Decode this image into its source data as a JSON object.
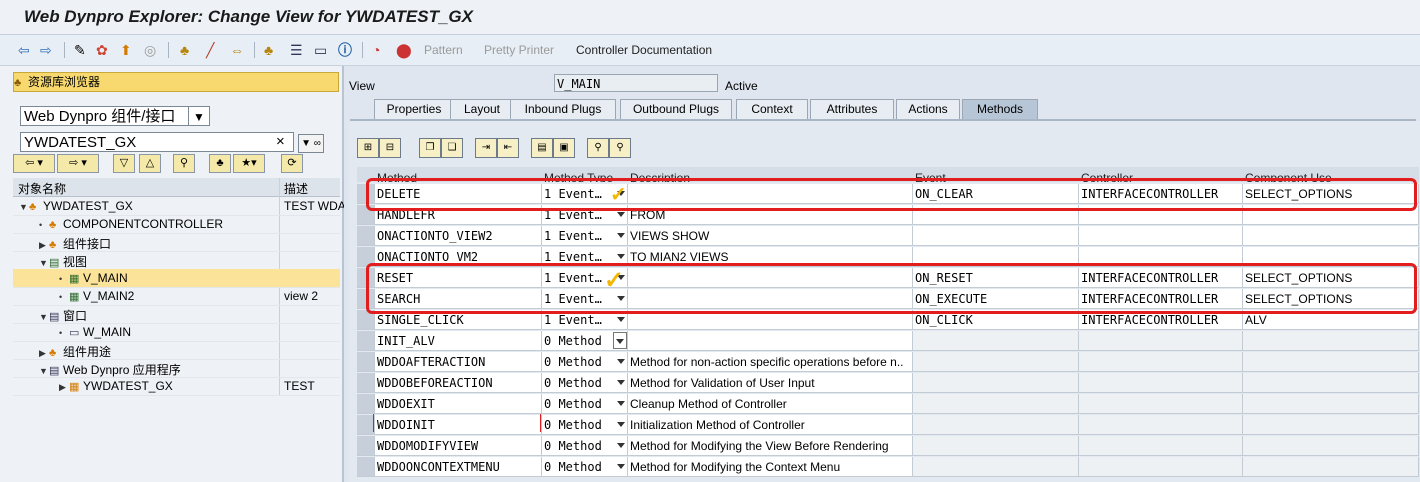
{
  "window": {
    "title": "Web Dynpro Explorer: Change View for YWDATEST_GX"
  },
  "toolbar": {
    "items": [
      "Pattern",
      "Pretty Printer",
      "Controller Documentation"
    ],
    "icons": [
      "back-icon",
      "forward-icon",
      "other-object-icon",
      "display-change-icon",
      "activate-icon",
      "where-used-icon",
      "mode-icon",
      "navigation-icon",
      "edit-icon",
      "check-icon",
      "hierarchy-icon",
      "enhance-icon",
      "layout-icon",
      "info-icon",
      "stop-icon",
      "test-icon"
    ]
  },
  "left": {
    "header": "资源库浏览器",
    "object_type": "Web Dynpro 组件/接口",
    "object_name": "YWDATEST_GX",
    "col_name": "对象名称",
    "col_desc": "描述",
    "tree": [
      {
        "label": "YWDATEST_GX",
        "desc": "TEST WDA"
      },
      {
        "label": "COMPONENTCONTROLLER",
        "desc": ""
      },
      {
        "label": "组件接口",
        "desc": ""
      },
      {
        "label": "视图",
        "desc": ""
      },
      {
        "label": "V_MAIN",
        "desc": ""
      },
      {
        "label": "V_MAIN2",
        "desc": "view 2"
      },
      {
        "label": "窗口",
        "desc": ""
      },
      {
        "label": "W_MAIN",
        "desc": ""
      },
      {
        "label": "组件用途",
        "desc": ""
      },
      {
        "label": "Web Dynpro 应用程序",
        "desc": ""
      },
      {
        "label": "YWDATEST_GX",
        "desc": "TEST"
      }
    ]
  },
  "view": {
    "label": "View",
    "name": "V_MAIN",
    "status": "Active",
    "tabs": [
      "Properties",
      "Layout",
      "Inbound Plugs",
      "Outbound Plugs",
      "Context",
      "Attributes",
      "Actions",
      "Methods"
    ],
    "active_tab": "Methods"
  },
  "grid": {
    "headers": [
      "Method",
      "Method Type",
      "Description",
      "Event",
      "Controller",
      "Component Use"
    ],
    "rows": [
      {
        "method": "DELETE",
        "type": "1 Event…",
        "desc": "",
        "event": "ON_CLEAR",
        "controller": "INTERFACECONTROLLER",
        "comp": "SELECT_OPTIONS"
      },
      {
        "method": "HANDLEFR",
        "type": "1 Event…",
        "desc": "FROM",
        "event": "",
        "controller": "",
        "comp": ""
      },
      {
        "method": "ONACTIONTO_VIEW2",
        "type": "1 Event…",
        "desc": "VIEWS SHOW",
        "event": "",
        "controller": "",
        "comp": ""
      },
      {
        "method": "ONACTIONTO_VM2",
        "type": "1 Event…",
        "desc": "TO MIAN2 VIEWS",
        "event": "",
        "controller": "",
        "comp": ""
      },
      {
        "method": "RESET",
        "type": "1 Event…",
        "desc": "",
        "event": "ON_RESET",
        "controller": "INTERFACECONTROLLER",
        "comp": "SELECT_OPTIONS"
      },
      {
        "method": "SEARCH",
        "type": "1 Event…",
        "desc": "",
        "event": "ON_EXECUTE",
        "controller": "INTERFACECONTROLLER",
        "comp": "SELECT_OPTIONS"
      },
      {
        "method": "SINGLE_CLICK",
        "type": "1 Event…",
        "desc": "",
        "event": "ON_CLICK",
        "controller": "INTERFACECONTROLLER",
        "comp": "ALV"
      },
      {
        "method": "INIT_ALV",
        "type": "0 Method",
        "desc": "",
        "event": "",
        "controller": "",
        "comp": ""
      },
      {
        "method": "WDDOAFTERACTION",
        "type": "0 Method",
        "desc": "Method for non-action specific operations before n..",
        "event": "",
        "controller": "",
        "comp": ""
      },
      {
        "method": "WDDOBEFOREACTION",
        "type": "0 Method",
        "desc": "Method for Validation of User Input",
        "event": "",
        "controller": "",
        "comp": ""
      },
      {
        "method": "WDDOEXIT",
        "type": "0 Method",
        "desc": "Cleanup Method of Controller",
        "event": "",
        "controller": "",
        "comp": ""
      },
      {
        "method": "WDDOINIT",
        "type": "0 Method",
        "desc": "Initialization Method of Controller",
        "event": "",
        "controller": "",
        "comp": ""
      },
      {
        "method": "WDDOMODIFYVIEW",
        "type": "0 Method",
        "desc": "Method for Modifying the View Before Rendering",
        "event": "",
        "controller": "",
        "comp": ""
      },
      {
        "method": "WDDOONCONTEXTMENU",
        "type": "0 Method",
        "desc": "Method for Modifying the Context Menu",
        "event": "",
        "controller": "",
        "comp": ""
      }
    ]
  },
  "colors": {
    "highlight_red": "#e21d1d",
    "check_yellow": "#f2b700",
    "selected_row": "#fbe39a"
  }
}
